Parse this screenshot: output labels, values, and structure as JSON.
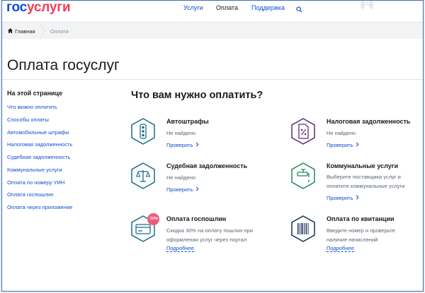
{
  "header": {
    "logo_part1": "гос",
    "logo_part2": "услуги",
    "nav": {
      "uslugi": "Услуги",
      "oplata": "Оплата",
      "podderzhka": "Поддержка"
    }
  },
  "breadcrumb": {
    "home": "Главная",
    "current": "Оплата"
  },
  "page_title": "Оплата госуслуг",
  "onpage": {
    "title": "На этой странице",
    "items": [
      "Что можно оплатить",
      "Способы оплаты",
      "Автомобильные штрафы",
      "Налоговая задолженность",
      "Судебная задолженность",
      "Коммунальные услуги",
      "Оплата по номеру УИН",
      "Оплата госпошлин",
      "Оплата через приложение"
    ]
  },
  "section_title": "Что вам нужно оплатить?",
  "cards": {
    "fines": {
      "title": "Автоштрафы",
      "status": "Не найдено",
      "link": "Проверить"
    },
    "tax": {
      "title": "Налоговая задолженность",
      "status": "Не найдено",
      "link": "Проверить"
    },
    "court": {
      "title": "Судебная задолженность",
      "status": "Не найдено",
      "link": "Проверить"
    },
    "utilities": {
      "title": "Коммунальные услуги",
      "desc1": "Выберите поставщика услуг и",
      "desc2": "оплатите коммунальные услуги",
      "link": "Проверить"
    },
    "duties": {
      "title": "Оплата госпошлин",
      "badge": "-30%",
      "desc1": "Скидка 30% на оплату пошлин при",
      "desc2": "оформлении услуг через портал",
      "link": "Подробнее"
    },
    "receipt": {
      "title": "Оплата по квитанции",
      "desc1": "Введите номер и проверьте",
      "desc2": "наличие начислений",
      "link": "Подробнее"
    }
  },
  "colors": {
    "brand_blue": "#0d4cd3",
    "brand_red": "#ee3f58",
    "teal": "#1a6e8a",
    "purple": "#5a2f7a",
    "green": "#1f8a5b",
    "navy": "#1a2e5a"
  }
}
